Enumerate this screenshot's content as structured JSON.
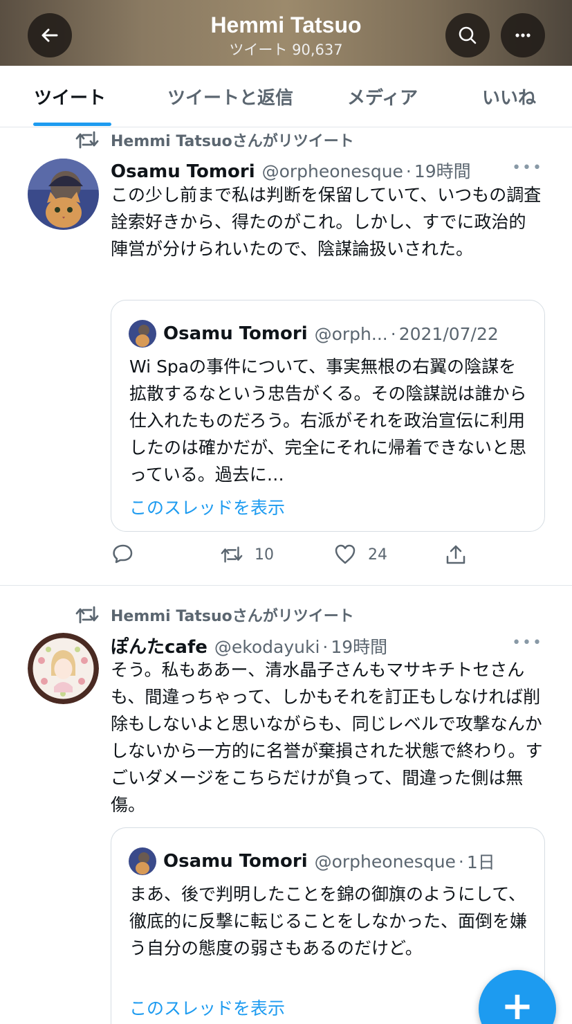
{
  "header": {
    "title": "Hemmi Tatsuo",
    "subtitle": "ツイート 90,637"
  },
  "tabs": [
    {
      "label": "ツイート"
    },
    {
      "label": "ツイートと返信"
    },
    {
      "label": "メディア"
    },
    {
      "label": "いいね"
    }
  ],
  "tweets": [
    {
      "retweet_label": "Hemmi Tatsuoさんがリツイート",
      "name": "Osamu Tomori",
      "handle": "@orpheonesque",
      "time": "19時間",
      "more": "•••",
      "text": "この少し前まで私は判断を保留していて、いつもの調査詮索好きから、得たのがこれ。しかし、すでに政治的陣営が分けられいたので、陰謀論扱いされた。",
      "quote": {
        "name": "Osamu Tomori",
        "handle": "@orph...",
        "time": "2021/07/22",
        "text": "Wi Spaの事件について、事実無根の右翼の陰謀を拡散するなという忠告がくる。その陰謀説は誰から仕入れたものだろう。右派がそれを政治宣伝に利用したのは確かだが、完全にそれに帰着できないと思っている。過去に…",
        "link": "このスレッドを表示"
      },
      "retweets": "10",
      "likes": "24"
    },
    {
      "retweet_label": "Hemmi Tatsuoさんがリツイート",
      "name": "ぽんたcafe",
      "handle": "@ekodayuki",
      "time": "19時間",
      "more": "•••",
      "text": "そう。私もああー、清水晶子さんもマサキチトセさんも、間違っちゃって、しかもそれを訂正もしなければ削除もしないよと思いながらも、同じレベルで攻撃なんかしないから一方的に名誉が棄損された状態で終わり。すごいダメージをこちらだけが負って、間違った側は無傷。",
      "quote": {
        "name": "Osamu Tomori",
        "handle": "@orpheonesque",
        "time": "1日",
        "text": "まあ、後で判明したことを錦の御旗のようにして、徹底的に反撃に転じることをしなかった、面倒を嫌う自分の態度の弱さもあるのだけど。",
        "link": "このスレッドを表示"
      }
    }
  ],
  "fab": {
    "label": "+"
  },
  "colors": {
    "accent": "#1d9bf0",
    "text": "#0f1419",
    "secondary": "#5b6670"
  }
}
